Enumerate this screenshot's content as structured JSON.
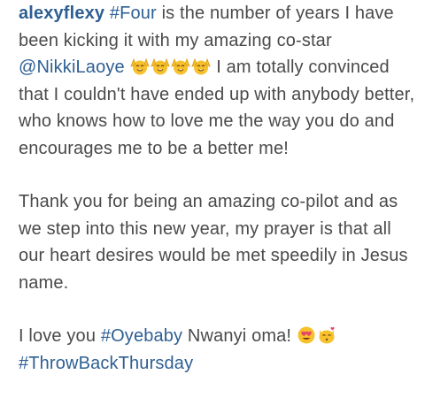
{
  "post": {
    "username": "alexyflexy",
    "p1": {
      "tag1": "#Four",
      "text1": " is the number of years I have been kicking it with my amazing co-star ",
      "mention": "@NikkiLaoye",
      "emoji_names": [
        "raising-hands-smile-icon",
        "raising-hands-smile-icon",
        "raising-hands-smile-icon",
        "raising-hands-smile-icon"
      ],
      "text2": " I am totally convinced that I couldn't have ended up with anybody better, who knows how to love me the way you do and encourages me to be a better me!"
    },
    "p2": {
      "text": "Thank you for being an amazing co-pilot and as we step into this new year, my prayer is that all our heart desires would be met speedily in Jesus name."
    },
    "p3": {
      "text1": "I love you ",
      "tag1": "#Oyebaby",
      "text2": " Nwanyi oma! ",
      "emoji_names": [
        "heart-eyes-face-icon",
        "kissing-cat-icon"
      ],
      "tag2": "#ThrowBackThursday"
    }
  },
  "colors": {
    "link": "#2d5f93",
    "text": "#4a4a4a",
    "emoji_yellow": "#f6c12c",
    "heart": "#e8446a"
  }
}
